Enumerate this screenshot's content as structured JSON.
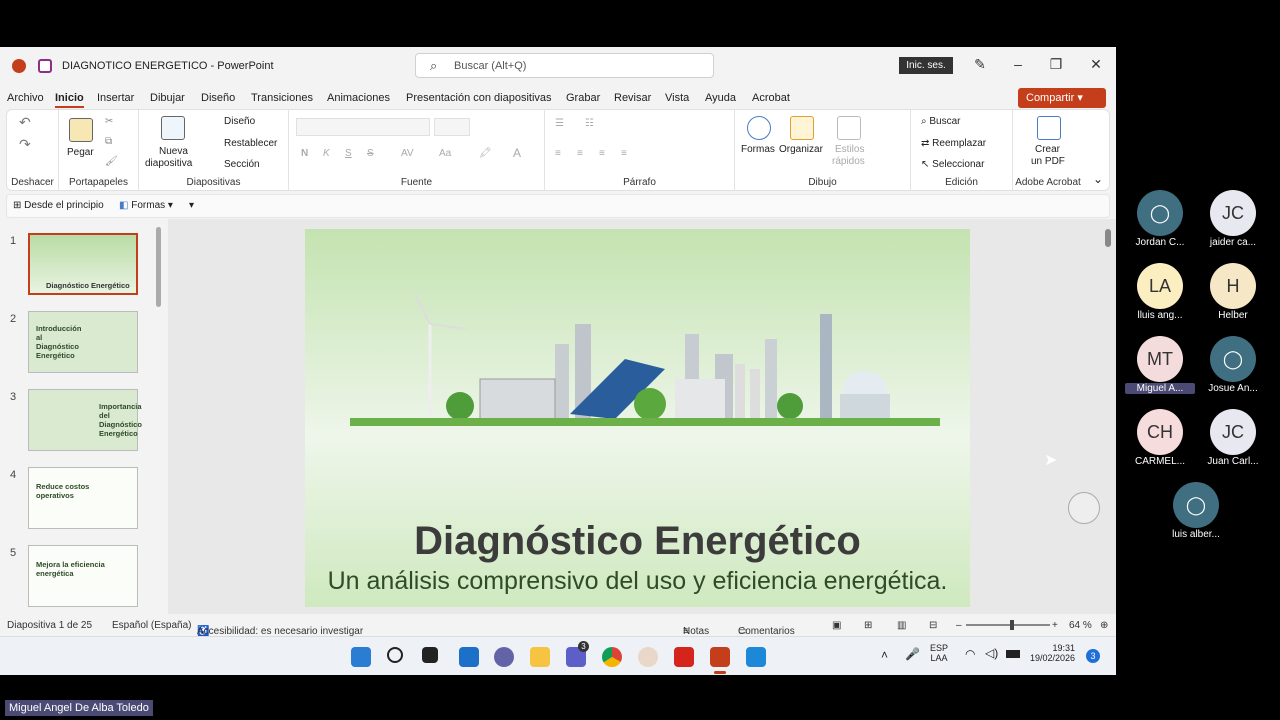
{
  "window": {
    "title": "DIAGNOTICO ENERGETICO",
    "app": "PowerPoint",
    "title_sep": "-",
    "search_placeholder": "Buscar (Alt+Q)",
    "signin": "Inic. ses.",
    "share": "Compartir"
  },
  "menu": [
    "Archivo",
    "Inicio",
    "Insertar",
    "Dibujar",
    "Diseño",
    "Transiciones",
    "Animaciones",
    "Presentación con diapositivas",
    "Grabar",
    "Revisar",
    "Vista",
    "Ayuda",
    "Acrobat"
  ],
  "ribbon": {
    "deshacer": "Deshacer",
    "portapapeles": {
      "label": "Portapapeles",
      "pegar": "Pegar"
    },
    "diapositivas": {
      "label": "Diapositivas",
      "nueva": "Nueva",
      "diapositiva": "diapositiva",
      "diseno": "Diseño",
      "restablecer": "Restablecer",
      "seccion": "Sección"
    },
    "fuente": {
      "label": "Fuente",
      "bold": "N",
      "italic": "K",
      "underline": "S",
      "strike": "S",
      "av": "AV",
      "aa": "Aa"
    },
    "parrafo": {
      "label": "Párrafo"
    },
    "dibujo": {
      "label": "Dibujo",
      "formas": "Formas",
      "organizar": "Organizar",
      "estilos": "Estilos",
      "rapidos": "rápidos"
    },
    "edicion": {
      "label": "Edición",
      "buscar": "Buscar",
      "reemplazar": "Reemplazar",
      "seleccionar": "Seleccionar"
    },
    "acrobat": {
      "label": "Adobe Acrobat",
      "crear": "Crear",
      "pdf": "un PDF"
    }
  },
  "quick_access": {
    "desde": "Desde el principio",
    "formas": "Formas"
  },
  "thumbnails": [
    {
      "num": "1",
      "title": "Diagnóstico Energético"
    },
    {
      "num": "2",
      "title": "Introducción al Diagnóstico Energético"
    },
    {
      "num": "3",
      "title": "Importancia del Diagnóstico Energético"
    },
    {
      "num": "4",
      "title": "Reduce costos operativos"
    },
    {
      "num": "5",
      "title": "Mejora la eficiencia energética"
    }
  ],
  "slide": {
    "title": "Diagnóstico Energético",
    "subtitle": "Un análisis comprensivo del uso y eficiencia energética."
  },
  "status": {
    "slide": "Diapositiva 1 de 25",
    "lang": "Español (España)",
    "access": "Accesibilidad: es necesario investigar",
    "notes": "Notas",
    "comments": "Comentarios",
    "zoom": "64 %",
    "zoom_fraction": 0.55
  },
  "taskbar": {
    "lang1": "ESP",
    "lang2": "LAA",
    "time": "19:31",
    "date": "19/02/2026",
    "badge_chat": "3",
    "badge_notif": "3"
  },
  "participants": [
    {
      "initials": "",
      "name": "Jordan C..."
    },
    {
      "initials": "JC",
      "name": "jaider ca..."
    },
    {
      "initials": "LA",
      "name": "lluis ang..."
    },
    {
      "initials": "H",
      "name": "Helber"
    },
    {
      "initials": "MT",
      "name": "Miguel A..."
    },
    {
      "initials": "",
      "name": "Josue An..."
    },
    {
      "initials": "CH",
      "name": "CARMEL..."
    },
    {
      "initials": "JC",
      "name": "Juan Carl..."
    },
    {
      "initials": "",
      "name": "luis alber..."
    }
  ],
  "presenter": "Miguel Angel De Alba Toledo",
  "colors": {
    "accent": "#c43e1c",
    "slide_green": "#c4e3b1"
  }
}
